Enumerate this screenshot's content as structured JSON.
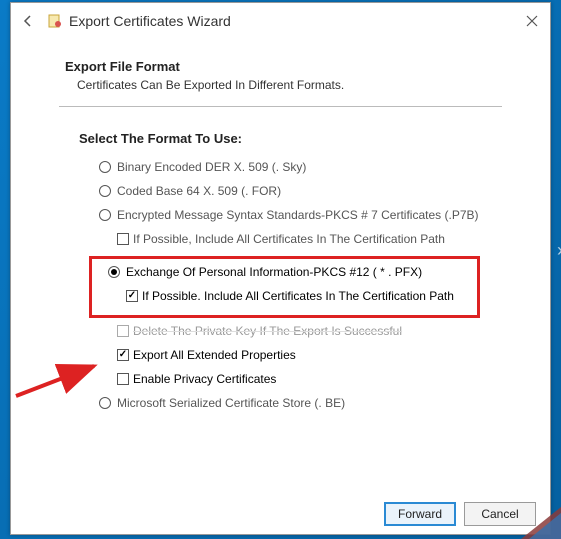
{
  "window": {
    "title": "Export Certificates Wizard"
  },
  "page": {
    "heading": "Export File Format",
    "subheading": "Certificates Can Be Exported In Different Formats.",
    "prompt": "Select The Format To Use:"
  },
  "options": {
    "der": {
      "label": "Binary Encoded DER X. 509 (. Sky)",
      "selected": false,
      "enabled": true
    },
    "base64": {
      "label": "Coded Base 64 X. 509 (. FOR)",
      "selected": false,
      "enabled": true
    },
    "pkcs7": {
      "label": "Encrypted Message Syntax Standards-PKCS # 7 Certificates (.P7B)",
      "selected": false,
      "enabled": true,
      "include_chain": {
        "label": "If Possible, Include All Certificates In The Certification Path",
        "checked": false
      }
    },
    "pkcs12": {
      "label": "Exchange Of Personal Information-PKCS #12 ( * . PFX)",
      "selected": true,
      "enabled": true,
      "include_chain": {
        "label": "If Possible. Include All Certificates In The Certification Path",
        "checked": true
      },
      "delete_key": {
        "label": "Delete The Private Key If The Export Is Successful",
        "checked": false
      },
      "export_ext": {
        "label": "Export All Extended Properties",
        "checked": true
      },
      "enable_privacy": {
        "label": "Enable Privacy Certificates",
        "checked": false
      }
    },
    "ms_store": {
      "label": "Microsoft Serialized Certificate Store (. BE)",
      "selected": false,
      "enabled": true
    }
  },
  "buttons": {
    "forward": "Forward",
    "cancel": "Cancel"
  },
  "annotations": {
    "highlight_box": true,
    "red_arrow": true
  }
}
